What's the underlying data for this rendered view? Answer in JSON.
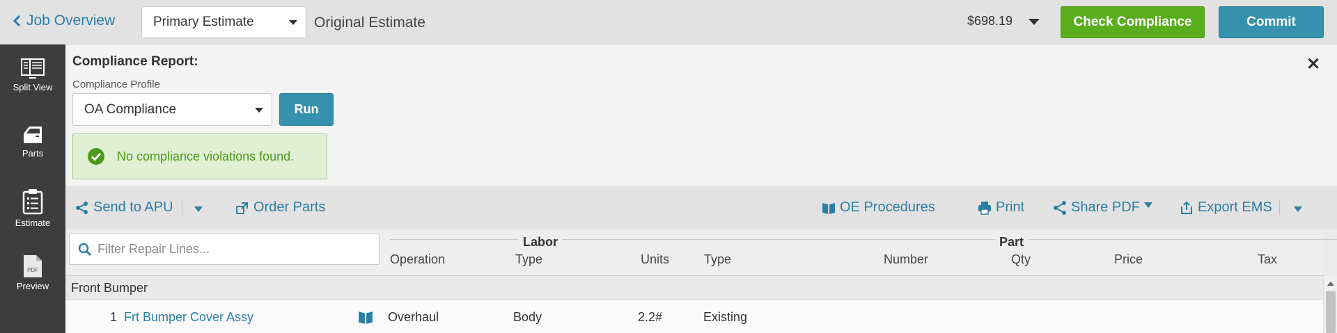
{
  "header": {
    "back_label": "Job Overview",
    "estimate_select": "Primary Estimate",
    "estimate_type": "Original Estimate",
    "total": "$698.19",
    "check_compliance_label": "Check Compliance",
    "commit_label": "Commit"
  },
  "sidebar": {
    "items": [
      {
        "label": "Split View",
        "icon": "split-view-icon"
      },
      {
        "label": "Parts",
        "icon": "car-door-icon"
      },
      {
        "label": "Estimate",
        "icon": "clipboard-icon"
      },
      {
        "label": "Preview",
        "icon": "pdf-icon",
        "icon_text": "PDF"
      }
    ]
  },
  "compliance": {
    "title": "Compliance Report:",
    "close_glyph": "✕",
    "profile_label": "Compliance Profile",
    "profile_value": "OA Compliance",
    "run_label": "Run",
    "result_message": "No compliance violations found."
  },
  "toolbar": {
    "send_to_apu": "Send to APU",
    "order_parts": "Order Parts",
    "oe_procedures": "OE Procedures",
    "print": "Print",
    "share_pdf": "Share PDF",
    "export_ems": "Export EMS"
  },
  "grid": {
    "filter_placeholder": "Filter Repair Lines...",
    "labor_group": "Labor",
    "part_group": "Part",
    "columns": {
      "operation": "Operation",
      "labor_type": "Type",
      "units": "Units",
      "part_type": "Type",
      "number": "Number",
      "qty": "Qty",
      "price": "Price",
      "tax": "Tax"
    },
    "group_name": "Front Bumper",
    "rows": [
      {
        "line": "1",
        "description": "Frt Bumper Cover Assy",
        "operation": "Overhaul",
        "labor_type": "Body",
        "units": "2.2#",
        "part_type": "Existing"
      }
    ]
  },
  "colors": {
    "accent": "#2a7fa5",
    "compliance_green": "#5aae1d",
    "commit_blue": "#3591ad",
    "success_bg": "#dff0d4",
    "sidebar_bg": "#3d3d3d"
  }
}
